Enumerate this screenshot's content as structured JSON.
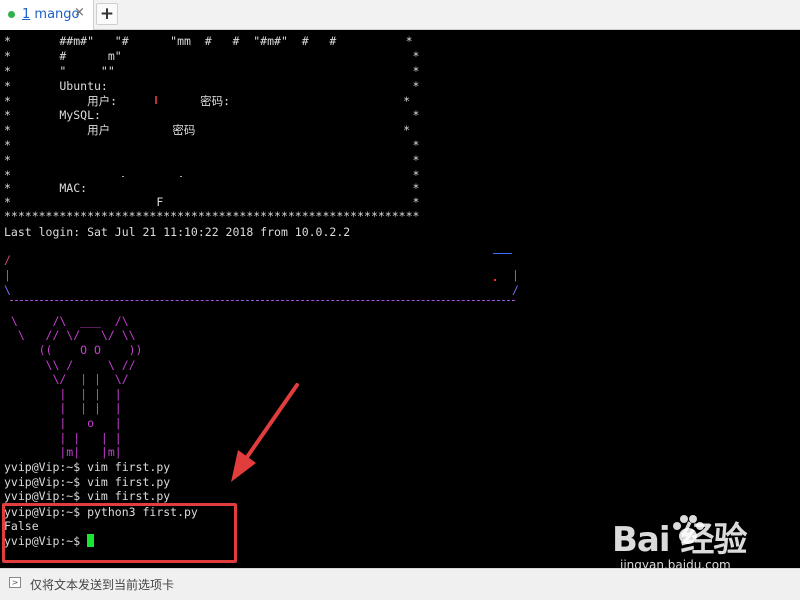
{
  "tab": {
    "number": "1",
    "name": "mango",
    "close": "×",
    "new_tab": "+"
  },
  "terminal": {
    "banner": [
      "*       ##m#\"   \"#      \"mm  #   #  \"#m#\"  #   #          *",
      "*       #      m\"                                          *",
      "*       \"     \"\"                                           *",
      "*       Ubuntu:                                            *",
      "*           用户:            密码:                         *",
      "*       MySQL:                                             *",
      "*           用户         密码                              *",
      "*                                                          *",
      "*                                                          *",
      "*                                                          *",
      "*       MAC:                                               *",
      "*                     F                                    *",
      "************************************************************"
    ],
    "last_login": "Last login: Sat Jul 21 11:10:22 2018 from 10.0.2.2",
    "art_edges": [
      "/",
      "|",
      "\\",
      "|",
      "/"
    ],
    "art_figure": [
      " \\     /\\  ___  /\\",
      "  \\   // \\/   \\/ \\\\",
      "     ((    O O    ))",
      "      \\\\ /     \\ //",
      "       \\/  | |  \\/",
      "        |  | |  |",
      "        |  | |  |",
      "        |   o   |",
      "        | |   | |",
      "        |m|   |m|"
    ],
    "commands": [
      "yvip@Vip:~$ vim first.py",
      "yvip@Vip:~$ vim first.py",
      "yvip@Vip:~$ vim first.py",
      "yvip@Vip:~$ python3 first.py",
      "False",
      "yvip@Vip:~$ "
    ]
  },
  "status_bar": {
    "icon": "send-text-icon",
    "text": "仅将文本发送到当前选项卡"
  },
  "watermark": {
    "brand": "Bai  经验",
    "url": "jingyan.baidu.com"
  },
  "colors": {
    "accent": "#e23d3d",
    "cursor": "#19e62f",
    "art": "#c63fd1"
  }
}
